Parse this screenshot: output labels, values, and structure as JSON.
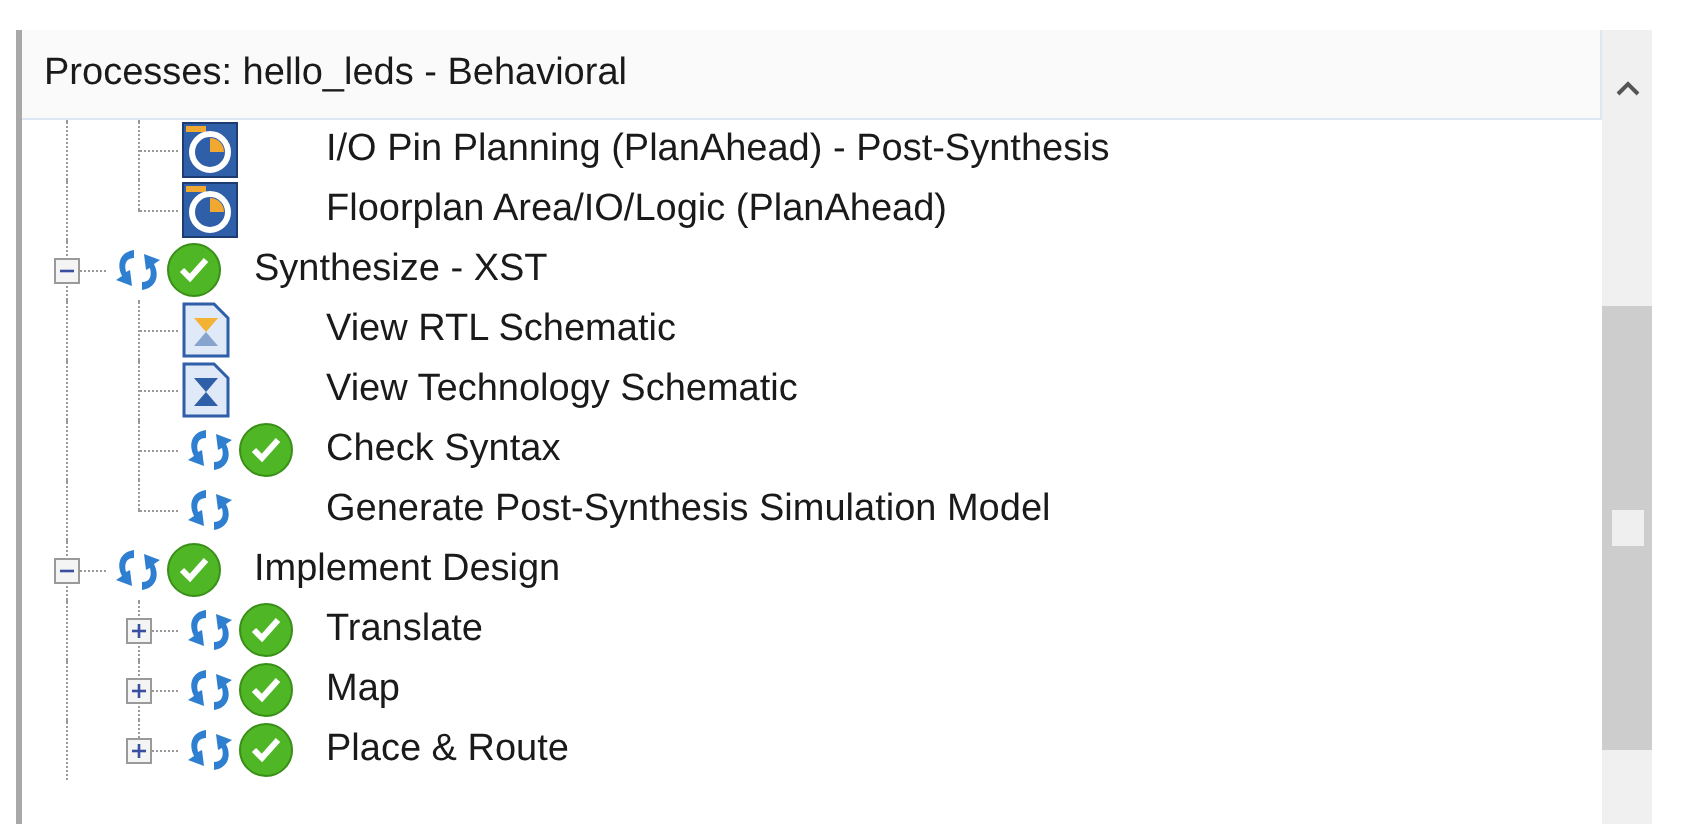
{
  "panel": {
    "title": "Processes: hello_leds - Behavioral"
  },
  "continued_children": [
    {
      "label": "I/O Pin Planning (PlanAhead) - Post-Synthesis",
      "kind": "planahead"
    },
    {
      "label": "Floorplan Area/IO/Logic (PlanAhead)",
      "kind": "planahead"
    }
  ],
  "tree": [
    {
      "label": "Synthesize - XST",
      "kind": "process",
      "done": true,
      "expanded": true,
      "children": [
        {
          "label": "View RTL Schematic",
          "kind": "rtl_schematic"
        },
        {
          "label": "View Technology Schematic",
          "kind": "tech_schematic"
        },
        {
          "label": "Check Syntax",
          "kind": "process",
          "done": true
        },
        {
          "label": "Generate Post-Synthesis Simulation Model",
          "kind": "process",
          "done": false
        }
      ]
    },
    {
      "label": "Implement Design",
      "kind": "process",
      "done": true,
      "expanded": true,
      "children": [
        {
          "label": "Translate",
          "kind": "process",
          "done": true,
          "expanded": false
        },
        {
          "label": "Map",
          "kind": "process",
          "done": true,
          "expanded": false
        },
        {
          "label": "Place & Route",
          "kind": "process",
          "done": true,
          "expanded": false
        }
      ]
    }
  ]
}
